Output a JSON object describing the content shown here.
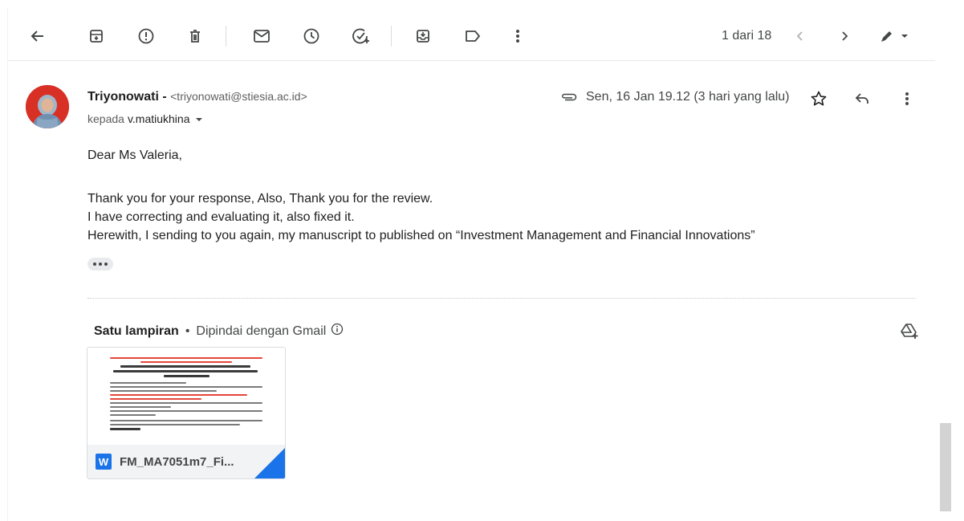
{
  "toolbar": {
    "back": "arrow-left-icon",
    "archive": "archive-icon",
    "report_spam": "report-spam-icon",
    "delete": "trash-icon",
    "mark_unread": "mail-icon",
    "snooze": "clock-icon",
    "add_task": "add-task-icon",
    "move_to": "move-to-inbox-icon",
    "labels": "label-icon",
    "more": "more-vert-icon",
    "pager": "1 dari 18",
    "prev": "chevron-left-icon",
    "next": "chevron-right-icon",
    "input_tools": "pen-icon"
  },
  "message": {
    "sender_name": "Triyonowati",
    "sender_dash": " - ",
    "sender_email": "<triyonowati@stiesia.ac.id>",
    "to_prefix": "kepada",
    "to_name": "v.matiukhina",
    "date": "Sen, 16 Jan 19.12 (3 hari yang lalu)",
    "body": {
      "greeting": "Dear Ms Valeria,",
      "line1": "Thank you for your response, Also, Thank you for the review.",
      "line2": "I have correcting and evaluating it, also fixed it.",
      "line3": "Herewith, I sending to you again, my manuscript to published on “Investment Management and Financial Innovations”"
    }
  },
  "attachments": {
    "count_label": "Satu lampiran",
    "separator": "•",
    "scan_label": "Dipindai dengan Gmail",
    "file": {
      "type_badge": "W",
      "name": "FM_MA7051m7_Fi..."
    }
  },
  "colors": {
    "accent": "#1a73e8",
    "avatar_bg": "#d93025",
    "text_primary": "#1f1f1f",
    "text_secondary": "#444746"
  }
}
